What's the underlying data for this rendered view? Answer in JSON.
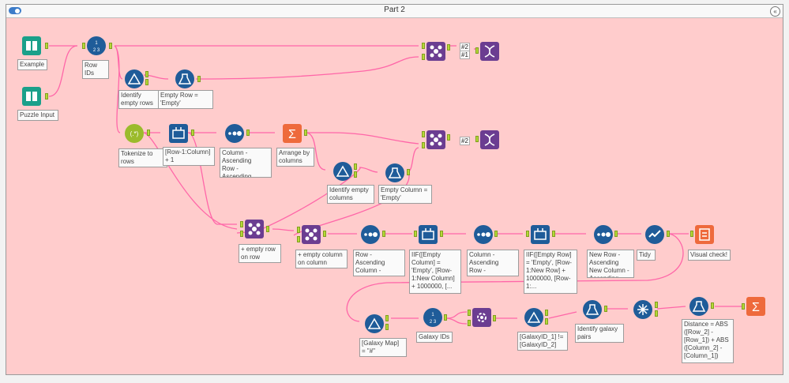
{
  "container": {
    "title": "Part 2"
  },
  "tools": [
    {
      "id": "example",
      "label": "Example",
      "icon": "book-icon"
    },
    {
      "id": "puzzle",
      "label": "Puzzle Input",
      "icon": "book-icon"
    },
    {
      "id": "rowids",
      "label": "Row IDs",
      "icon": "record-id-icon"
    },
    {
      "id": "filt1",
      "label": "Identify empty rows",
      "icon": "filter-icon"
    },
    {
      "id": "form1",
      "label": "Empty Row = 'Empty'",
      "icon": "formula-icon"
    },
    {
      "id": "join1",
      "label": "",
      "icon": "join-icon"
    },
    {
      "id": "dna1",
      "label": "",
      "icon": "dna-icon"
    },
    {
      "id": "regex",
      "label": "Tokenize to rows",
      "icon": "regex-icon"
    },
    {
      "id": "multi1",
      "label": "[Row-1:Column] + 1",
      "icon": "multi-row-icon"
    },
    {
      "id": "sort1",
      "label": "Column - Ascending\nRow - Ascending",
      "icon": "sort-icon"
    },
    {
      "id": "summ1",
      "label": "Arrange by columns",
      "icon": "summarize-icon"
    },
    {
      "id": "join2",
      "label": "",
      "icon": "join-icon"
    },
    {
      "id": "dna2",
      "label": "",
      "icon": "dna-icon"
    },
    {
      "id": "filt2",
      "label": "Identify empty columns",
      "icon": "filter-icon"
    },
    {
      "id": "form2",
      "label": "Empty Column = 'Empty'",
      "icon": "formula-icon"
    },
    {
      "id": "join3",
      "label": "+ empty row on row",
      "icon": "join-icon"
    },
    {
      "id": "join4",
      "label": "+ empty column on column",
      "icon": "join-icon"
    },
    {
      "id": "sort2",
      "label": "Row - Ascending\nColumn - Ascending",
      "icon": "sort-icon"
    },
    {
      "id": "multi2",
      "label": "IIF([Empty Column] = 'Empty', [Row-1:New Column] + 1000000, [...",
      "icon": "multi-row-icon"
    },
    {
      "id": "sort3",
      "label": "Column - Ascending\nRow - Ascending",
      "icon": "sort-icon"
    },
    {
      "id": "multi3",
      "label": "IIF([Empty Row] = 'Empty', [Row-1:New Row] + 1000000, [Row-1:...",
      "icon": "multi-row-icon"
    },
    {
      "id": "sort4",
      "label": "New Row - Ascending\nNew Column - Ascending",
      "icon": "sort-icon"
    },
    {
      "id": "tidy",
      "label": "Tidy",
      "icon": "select-icon"
    },
    {
      "id": "visual",
      "label": "Visual check!",
      "icon": "report-icon"
    },
    {
      "id": "filt3",
      "label": "[Galaxy Map] = \"#\"",
      "icon": "filter-icon"
    },
    {
      "id": "galaxyids",
      "label": "Galaxy IDs",
      "icon": "record-id-icon"
    },
    {
      "id": "append",
      "label": "",
      "icon": "append-icon"
    },
    {
      "id": "filt4",
      "label": "[GalaxyID_1] != [GalaxyID_2]",
      "icon": "filter-icon"
    },
    {
      "id": "form3",
      "label": "Identify galaxy pairs",
      "icon": "formula-icon"
    },
    {
      "id": "uniq",
      "label": "",
      "icon": "unique-icon"
    },
    {
      "id": "form4",
      "label": "Distance = ABS ([Row_2] - [Row_1]) + ABS ([Column_2] - [Column_1])",
      "icon": "formula-icon"
    },
    {
      "id": "summ2",
      "label": "",
      "icon": "summarize-icon"
    }
  ],
  "tags": {
    "dna1_a": "#2",
    "dna1_b": "#1",
    "dna2_a": "#2"
  },
  "colors": {
    "canvas": "#ffcccc",
    "wire": "#ff66a8",
    "record": "#1f5c99",
    "input": "#1aa08a",
    "transform": "#6b3d91",
    "summarize": "#ee6a3c",
    "anchor": "#b6d936"
  }
}
